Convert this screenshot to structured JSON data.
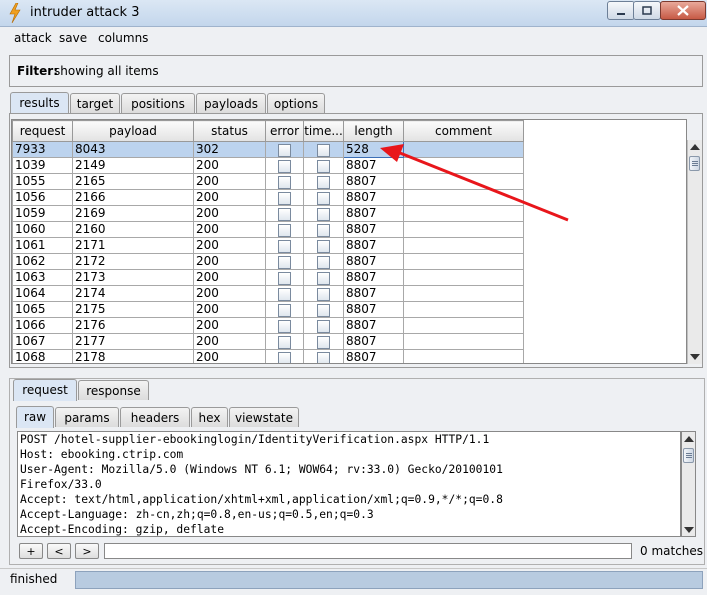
{
  "window": {
    "title": "intruder attack 3"
  },
  "menu": [
    "attack",
    "save",
    "columns"
  ],
  "filter": {
    "label": "Filter:",
    "text": "showing all items"
  },
  "main_tabs": [
    "results",
    "target",
    "positions",
    "payloads",
    "options"
  ],
  "table": {
    "columns": [
      "request",
      "payload",
      "status",
      "error",
      "time...",
      "length",
      "comment"
    ],
    "rows": [
      [
        "7933",
        "8043",
        "302",
        "",
        "",
        "528",
        ""
      ],
      [
        "1039",
        "2149",
        "200",
        "",
        "",
        "8807",
        ""
      ],
      [
        "1055",
        "2165",
        "200",
        "",
        "",
        "8807",
        ""
      ],
      [
        "1056",
        "2166",
        "200",
        "",
        "",
        "8807",
        ""
      ],
      [
        "1059",
        "2169",
        "200",
        "",
        "",
        "8807",
        ""
      ],
      [
        "1060",
        "2160",
        "200",
        "",
        "",
        "8807",
        ""
      ],
      [
        "1061",
        "2171",
        "200",
        "",
        "",
        "8807",
        ""
      ],
      [
        "1062",
        "2172",
        "200",
        "",
        "",
        "8807",
        ""
      ],
      [
        "1063",
        "2173",
        "200",
        "",
        "",
        "8807",
        ""
      ],
      [
        "1064",
        "2174",
        "200",
        "",
        "",
        "8807",
        ""
      ],
      [
        "1065",
        "2175",
        "200",
        "",
        "",
        "8807",
        ""
      ],
      [
        "1066",
        "2176",
        "200",
        "",
        "",
        "8807",
        ""
      ],
      [
        "1067",
        "2177",
        "200",
        "",
        "",
        "8807",
        ""
      ],
      [
        "1068",
        "2178",
        "200",
        "",
        "",
        "8807",
        ""
      ]
    ]
  },
  "detail_tabs": [
    "request",
    "response"
  ],
  "view_tabs": [
    "raw",
    "params",
    "headers",
    "hex",
    "viewstate"
  ],
  "request_lines": [
    "POST /hotel-supplier-ebookinglogin/IdentityVerification.aspx HTTP/1.1",
    "Host: ebooking.ctrip.com",
    "User-Agent: Mozilla/5.0 (Windows NT 6.1; WOW64; rv:33.0) Gecko/20100101",
    "Firefox/33.0",
    "Accept: text/html,application/xhtml+xml,application/xml;q=0.9,*/*;q=0.8",
    "Accept-Language: zh-cn,zh;q=0.8,en-us;q=0.5,en;q=0.3",
    "Accept-Encoding: gzip, deflate"
  ],
  "search": {
    "buttons": [
      "+",
      "<",
      ">"
    ],
    "value": "",
    "matches": "0 matches"
  },
  "status": {
    "text": "finished"
  },
  "colors": {
    "arrow": "#e8161b",
    "selected_row": "#bcd3ee"
  }
}
